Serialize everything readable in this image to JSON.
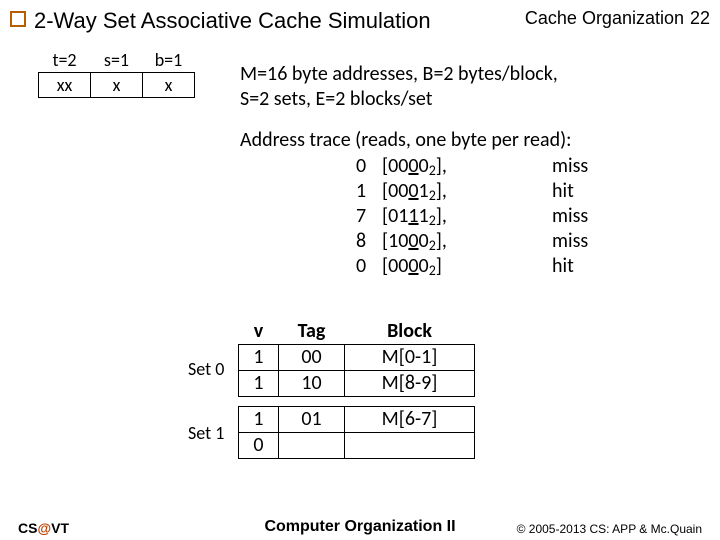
{
  "header": {
    "title": "2-Way Set Associative Cache Simulation",
    "section": "Cache Organization",
    "page": "22"
  },
  "addr": {
    "t_label": "t=2",
    "s_label": "s=1",
    "b_label": "b=1",
    "t_bits": "xx",
    "s_bits": "x",
    "b_bits": "x"
  },
  "params": {
    "line1": "M=16 byte addresses, B=2 bytes/block,",
    "line2": "S=2 sets, E=2 blocks/set"
  },
  "trace_title": "Address trace (reads, one byte per read):",
  "trace": [
    {
      "idx": "0",
      "prefix": "[00",
      "mid": "0",
      "suffix": "0",
      "status": "miss"
    },
    {
      "idx": "1",
      "prefix": "[00",
      "mid": "0",
      "suffix": "1",
      "status": "hit"
    },
    {
      "idx": "7",
      "prefix": "[01",
      "mid": "1",
      "suffix": "1",
      "status": "miss"
    },
    {
      "idx": "8",
      "prefix": "[10",
      "mid": "0",
      "suffix": "0",
      "status": "miss"
    },
    {
      "idx": "0",
      "prefix": "[00",
      "mid": "0",
      "suffix": "0",
      "status": "hit"
    }
  ],
  "cache": {
    "headers": {
      "v": "v",
      "tag": "Tag",
      "block": "Block"
    },
    "set0_label": "Set 0",
    "set1_label": "Set 1",
    "set0": [
      {
        "v": "1",
        "tag": "00",
        "block": "M[0-1]"
      },
      {
        "v": "1",
        "tag": "10",
        "block": "M[8-9]"
      }
    ],
    "set1": [
      {
        "v": "1",
        "tag": "01",
        "block": "M[6-7]"
      },
      {
        "v": "0",
        "tag": "",
        "block": ""
      }
    ]
  },
  "footer": {
    "left_cs": "CS",
    "left_at": "@",
    "left_vt": "VT",
    "center": "Computer Organization II",
    "right": "© 2005-2013 CS: APP & Mc.Quain"
  }
}
